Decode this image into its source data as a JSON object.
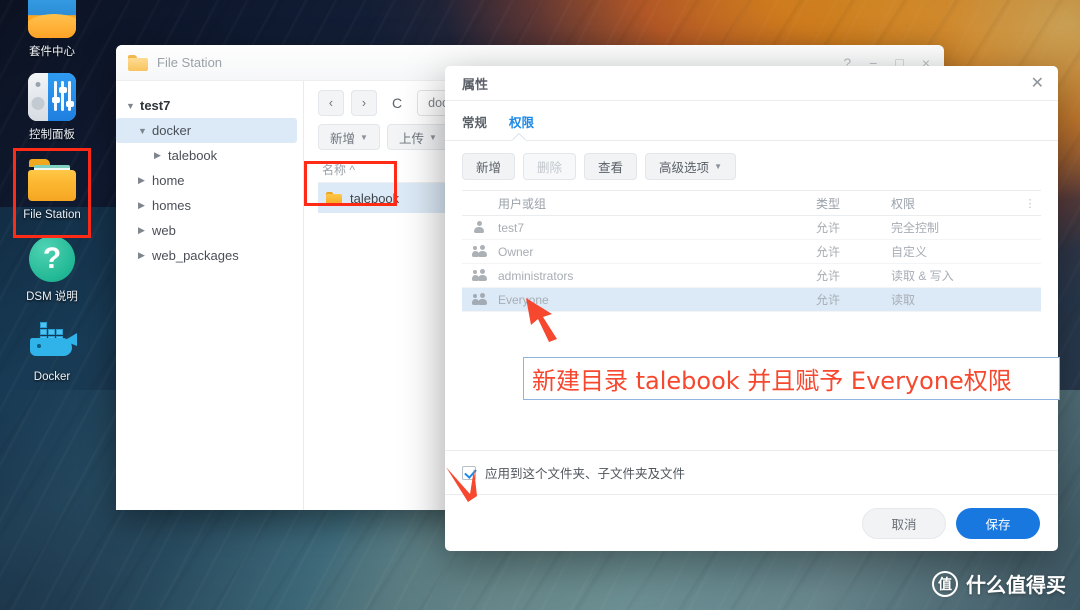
{
  "desktop": {
    "icons": [
      {
        "name": "package-center",
        "label": "套件中心",
        "glyph": "package-center-icon",
        "highlighted": false
      },
      {
        "name": "control-panel",
        "label": "控制面板",
        "glyph": "control-panel-icon",
        "highlighted": false
      },
      {
        "name": "file-station",
        "label": "File Station",
        "glyph": "file-station-icon",
        "highlighted": true
      },
      {
        "name": "dsm-help",
        "label": "DSM 说明",
        "glyph": "help-question-icon",
        "highlighted": false
      },
      {
        "name": "docker",
        "label": "Docker",
        "glyph": "docker-whale-icon",
        "highlighted": false
      }
    ]
  },
  "file_station": {
    "title": "File Station",
    "window_controls": {
      "help": "?",
      "minimize": "−",
      "maximize": "□",
      "close": "×"
    },
    "tree": [
      {
        "label": "test7",
        "depth": 0,
        "caret": "down",
        "selected": false
      },
      {
        "label": "docker",
        "depth": 1,
        "caret": "down",
        "selected": true
      },
      {
        "label": "talebook",
        "depth": 2,
        "caret": "right",
        "selected": false
      },
      {
        "label": "home",
        "depth": 1,
        "caret": "right",
        "selected": false
      },
      {
        "label": "homes",
        "depth": 1,
        "caret": "right",
        "selected": false
      },
      {
        "label": "web",
        "depth": 1,
        "caret": "right",
        "selected": false
      },
      {
        "label": "web_packages",
        "depth": 1,
        "caret": "right",
        "selected": false
      }
    ],
    "toolbar": {
      "back": "‹",
      "forward": "›",
      "refresh": "C",
      "path_value": "docker",
      "create": "新增",
      "upload": "上传"
    },
    "column_header": "名称",
    "sort_indicator": "^",
    "files": [
      {
        "name": "talebook",
        "type": "folder",
        "selected": true
      }
    ]
  },
  "properties_dialog": {
    "title": "属性",
    "close_label": "✕",
    "tabs": [
      {
        "label": "常规",
        "active": false
      },
      {
        "label": "权限",
        "active": true
      }
    ],
    "actions": [
      {
        "label": "新增",
        "disabled": false
      },
      {
        "label": "删除",
        "disabled": true
      },
      {
        "label": "查看",
        "disabled": false
      },
      {
        "label": "高级选项",
        "disabled": false,
        "has_caret": true
      }
    ],
    "table": {
      "headers": {
        "user_or_group": "用户或组",
        "type": "类型",
        "permission": "权限",
        "menu": "⋮"
      },
      "rows": [
        {
          "icon": "user-icon",
          "name": "test7",
          "type": "允许",
          "permission": "完全控制",
          "selected": false
        },
        {
          "icon": "group-icon",
          "name": "Owner",
          "type": "允许",
          "permission": "自定义",
          "selected": false
        },
        {
          "icon": "group-icon",
          "name": "administrators",
          "type": "允许",
          "permission": "读取 & 写入",
          "selected": false
        },
        {
          "icon": "group-icon",
          "name": "Everyone",
          "type": "允许",
          "permission": "读取",
          "selected": true
        }
      ]
    },
    "apply_checkbox": {
      "label": "应用到这个文件夹、子文件夹及文件",
      "checked": true
    },
    "footer": {
      "cancel": "取消",
      "save": "保存"
    }
  },
  "annotations": {
    "callout_text": "新建目录 talebook  并且赋予 Everyone权限",
    "callout_color": "#f6482f",
    "arrow_to_everyone": "red-arrow-icon",
    "arrow_to_checkbox": "red-arrow-icon",
    "highlight_color": "#ff2b17"
  },
  "watermark": {
    "logo_char": "值",
    "text": "什么值得买"
  }
}
